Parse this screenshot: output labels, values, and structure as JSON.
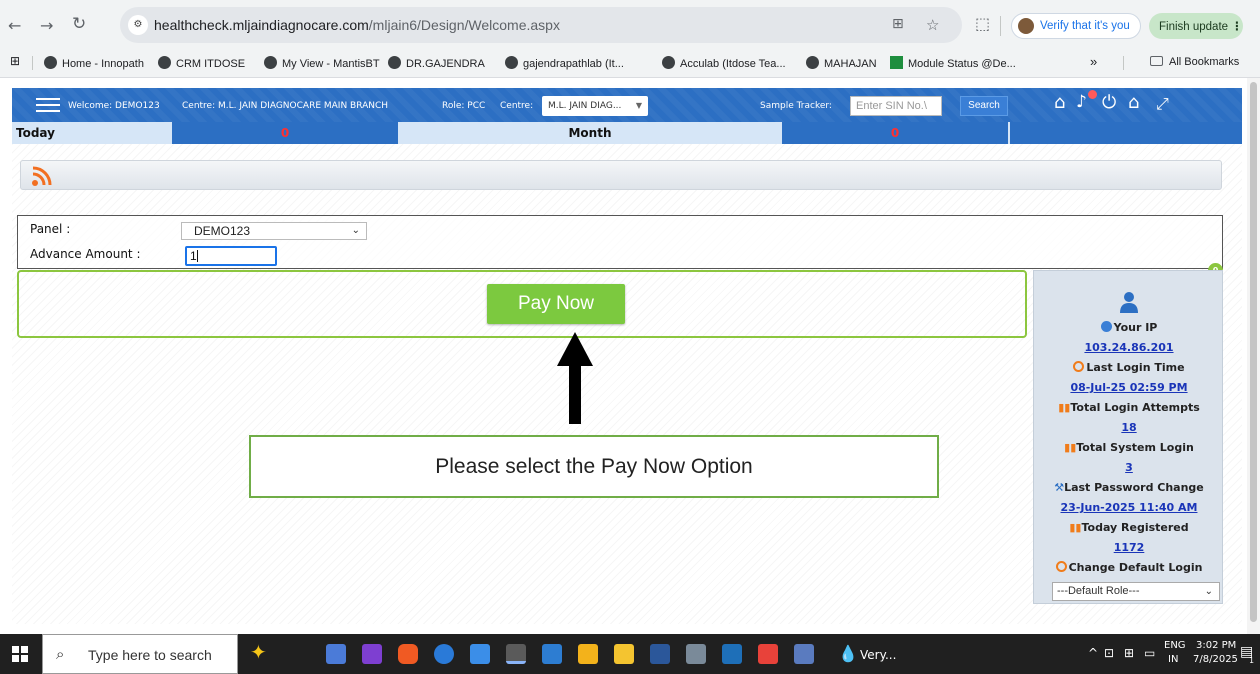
{
  "browser": {
    "url_domain": "healthcheck.mljaindiagnocare.com",
    "url_path": "/mljain6/Design/Welcome.aspx",
    "verify_label": "Verify that it's you",
    "finish_update_label": "Finish update",
    "bookmarks": [
      "Home - Innopath",
      "CRM ITDOSE",
      "My View - MantisBT",
      "DR.GAJENDRA",
      "gajendrapathlab (It...",
      "Acculab (Itdose Tea...",
      "MAHAJAN",
      "Module Status @De..."
    ],
    "all_bookmarks_label": "All Bookmarks",
    "overflow_label": "»"
  },
  "header": {
    "welcome": "Welcome: DEMO123",
    "centre": "Centre: M.L. JAIN DIAGNOCARE MAIN BRANCH",
    "role": "Role: PCC",
    "centre_label": "Centre:",
    "centre_select_value": "M.L. JAIN DIAG...",
    "sample_tracker_label": "Sample Tracker:",
    "sin_placeholder": "Enter SIN No.\\",
    "search_label": "Search"
  },
  "stats": {
    "today_label": "Today",
    "today_value": "0",
    "month_label": "Month",
    "month_value": "0"
  },
  "form": {
    "panel_label": "Panel :",
    "panel_value": "DEMO123",
    "advance_label": "Advance Amount :",
    "advance_value": "1",
    "pay_now_label": "Pay Now"
  },
  "callout": {
    "text": "Please select the Pay Now Option"
  },
  "info_panel": {
    "badge": "0",
    "ip_label": "Your IP",
    "ip_value": "103.24.86.201",
    "last_login_label": "Last Login Time",
    "last_login_value": "08-Jul-25 02:59 PM",
    "total_login_attempts_label": "Total Login Attempts",
    "total_login_attempts_value": "18",
    "total_system_login_label": "Total System Login",
    "total_system_login_value": "3",
    "last_password_change_label": "Last Password Change",
    "last_password_change_value": "23-Jun-2025 11:40 AM",
    "today_registered_label": "Today Registered",
    "today_registered_value": "1172",
    "change_default_login_label": "Change Default Login",
    "default_role_value": "---Default Role---"
  },
  "taskbar": {
    "search_placeholder": "Type here to search",
    "weather_label": "Very...",
    "lang_line1": "ENG",
    "lang_line2": "IN",
    "time": "3:02 PM",
    "date": "7/8/2025",
    "notif_count": "1"
  },
  "colors": {
    "header_blue": "#2c6fc3",
    "pay_green": "#7cc93f",
    "callout_border": "#70ad47",
    "link_blue": "#1a35b8"
  }
}
